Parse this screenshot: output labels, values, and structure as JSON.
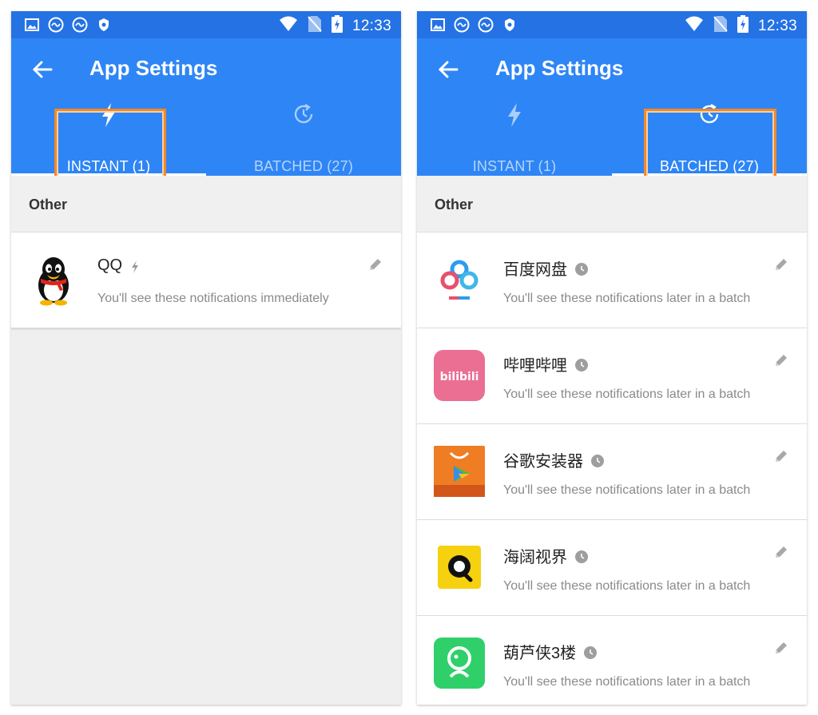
{
  "status_bar": {
    "time": "12:33"
  },
  "left_screen": {
    "title": "App Settings",
    "tabs": [
      {
        "label": "INSTANT (1)",
        "icon": "lightning-icon",
        "selected": true
      },
      {
        "label": "BATCHED (27)",
        "icon": "clock-history-icon",
        "selected": false
      }
    ],
    "section_title": "Other",
    "items": [
      {
        "name": "QQ",
        "badge": "lightning-icon",
        "description": "You'll see these notifications immediately"
      }
    ]
  },
  "right_screen": {
    "title": "App Settings",
    "tabs": [
      {
        "label": "INSTANT (1)",
        "icon": "lightning-icon",
        "selected": false
      },
      {
        "label": "BATCHED (27)",
        "icon": "clock-history-icon",
        "selected": true
      }
    ],
    "section_title": "Other",
    "items": [
      {
        "name": "百度网盘",
        "badge": "clock-icon",
        "description": "You'll see these notifications later in a batch"
      },
      {
        "name": "哔哩哔哩",
        "badge": "clock-icon",
        "description": "You'll see these notifications later in a batch",
        "icon_text": "bilibili"
      },
      {
        "name": "谷歌安装器",
        "badge": "clock-icon",
        "description": "You'll see these notifications later in a batch"
      },
      {
        "name": "海阔视界",
        "badge": "clock-icon",
        "description": "You'll see these notifications later in a batch"
      },
      {
        "name": "葫芦侠3楼",
        "badge": "clock-icon",
        "description": "You'll see these notifications later in a batch"
      }
    ]
  },
  "colors": {
    "status_bar": "#2472e4",
    "app_bar": "#2e85f5",
    "highlight": "#f0892a",
    "background": "#efefef"
  }
}
